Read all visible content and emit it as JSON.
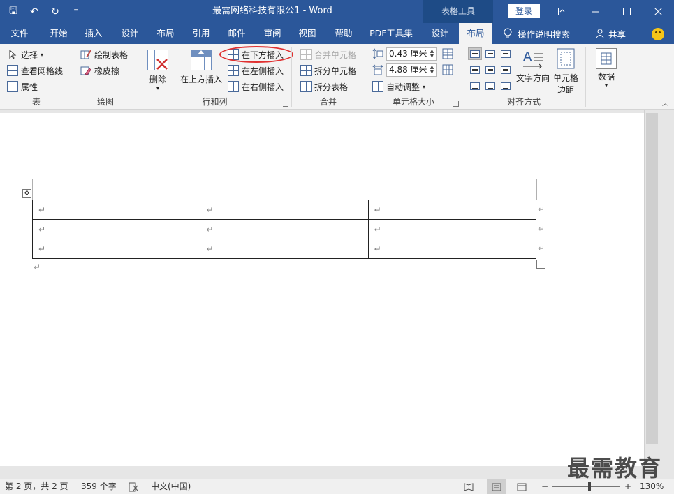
{
  "titlebar": {
    "doc_title": "最需网络科技有限公1  -  Word",
    "context_tools": "表格工具",
    "login": "登录",
    "qat_save": "🖫",
    "qat_undo": "↶",
    "qat_redo": "↻",
    "qat_more": "⁼"
  },
  "tabs": [
    "文件",
    "开始",
    "插入",
    "设计",
    "布局",
    "引用",
    "邮件",
    "审阅",
    "视图",
    "帮助",
    "PDF工具集",
    "设计",
    "布局"
  ],
  "active_tab": "布局",
  "tell_me": "操作说明搜索",
  "share": "共享",
  "ribbon": {
    "table": {
      "select": "选择",
      "gridlines": "查看网格线",
      "properties": "属性",
      "label": "表"
    },
    "draw": {
      "draw_table": "绘制表格",
      "eraser": "橡皮擦",
      "label": "绘图"
    },
    "rows_cols": {
      "delete": "删除",
      "insert_above": "在上方插入",
      "insert_below": "在下方插入",
      "insert_left": "在左侧插入",
      "insert_right": "在右侧插入",
      "label": "行和列"
    },
    "merge": {
      "merge_cells": "合并单元格",
      "split_cells": "拆分单元格",
      "split_table": "拆分表格",
      "label": "合并"
    },
    "cell_size": {
      "height": "0.43 厘米",
      "width": "4.88 厘米",
      "autofit": "自动调整",
      "label": "单元格大小"
    },
    "alignment": {
      "text_direction": "文字方向",
      "cell_margins_1": "单元格",
      "cell_margins_2": "边距",
      "label": "对齐方式"
    },
    "data": {
      "label": "数据"
    }
  },
  "document": {
    "paragraph_mark": "↵",
    "table": {
      "rows": [
        [
          "↵",
          "↵",
          "↵"
        ],
        [
          "↵",
          "↵",
          "↵"
        ],
        [
          "↵",
          "↵",
          "↵"
        ]
      ],
      "row_end_marks": [
        "↵",
        "↵",
        "↵"
      ]
    }
  },
  "status": {
    "page": "第 2 页，共 2 页",
    "words": "359 个字",
    "language": "中文(中国)",
    "zoom": "130%",
    "zoom_minus": "−",
    "zoom_plus": "+"
  },
  "watermark": "最需教育",
  "colors": {
    "brand": "#2b579a",
    "highlight_oval": "#e03030"
  }
}
